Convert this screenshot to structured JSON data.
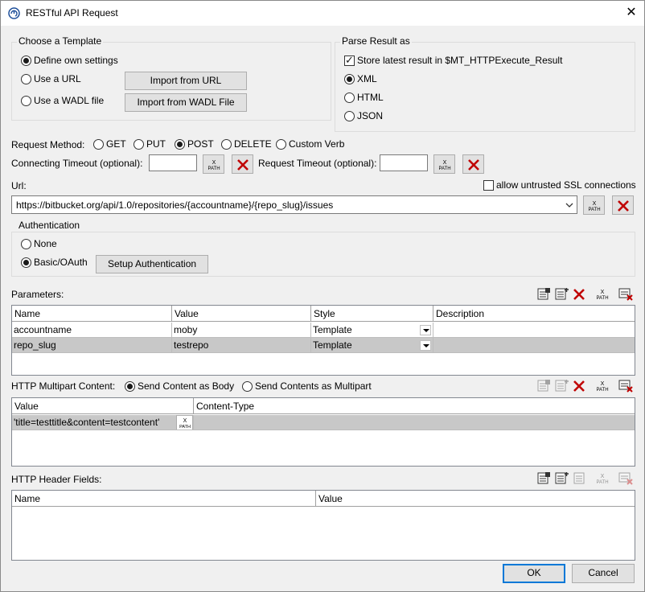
{
  "window": {
    "title": "RESTful API Request"
  },
  "template": {
    "legend": "Choose a Template",
    "options": [
      "Define own settings",
      "Use a URL",
      "Use a WADL file"
    ],
    "selected_index": 0,
    "import_url_label": "Import from URL",
    "import_wadl_label": "Import from WADL File"
  },
  "parse": {
    "legend": "Parse Result as",
    "store_label": "Store latest result in $MT_HTTPExecute_Result",
    "store_checked": true,
    "options": [
      "XML",
      "HTML",
      "JSON"
    ],
    "selected_index": 0
  },
  "method": {
    "label": "Request Method:",
    "options": [
      "GET",
      "PUT",
      "POST",
      "DELETE",
      "Custom Verb"
    ],
    "selected_index": 2
  },
  "timeouts": {
    "connecting_label": "Connecting Timeout (optional):",
    "connecting_value": "",
    "request_label": "Request Timeout (optional):",
    "request_value": ""
  },
  "url": {
    "label": "Url:",
    "value": "https://bitbucket.org/api/1.0/repositories/{accountname}/{repo_slug}/issues",
    "untrusted_ssl_label": "allow untrusted SSL connections",
    "untrusted_ssl_checked": false
  },
  "auth": {
    "legend": "Authentication",
    "options": [
      "None",
      "Basic/OAuth"
    ],
    "selected_index": 1,
    "setup_label": "Setup Authentication"
  },
  "parameters": {
    "label": "Parameters:",
    "columns": [
      "Name",
      "Value",
      "Style",
      "Description"
    ],
    "rows": [
      {
        "name": "accountname",
        "value": "moby",
        "style": "Template",
        "description": ""
      },
      {
        "name": "repo_slug",
        "value": "testrepo",
        "style": "Template",
        "description": ""
      }
    ],
    "selected_row": 1
  },
  "multipart": {
    "label": "HTTP Multipart Content:",
    "options": [
      "Send Content as Body",
      "Send Contents as Multipart"
    ],
    "selected_index": 0,
    "columns": [
      "Value",
      "Content-Type"
    ],
    "rows": [
      {
        "value": "'title=testtitle&content=testcontent'",
        "content_type": ""
      }
    ]
  },
  "headers": {
    "label": "HTTP Header Fields:",
    "columns": [
      "Name",
      "Value"
    ],
    "rows": []
  },
  "xpath_icon_text": {
    "top": "X",
    "bottom": "PATH"
  },
  "footer": {
    "ok_label": "OK",
    "cancel_label": "Cancel"
  },
  "colors": {
    "delete_red": "#c00000",
    "focus_blue": "#0078d7",
    "selected_row": "#c8c8c8"
  }
}
